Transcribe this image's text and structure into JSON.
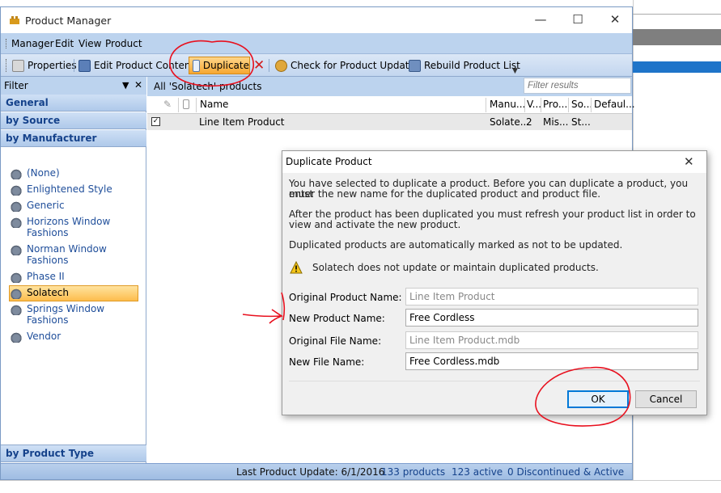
{
  "window": {
    "title": "Product Manager"
  },
  "menu": [
    "Manager",
    "Edit",
    "View",
    "Product"
  ],
  "toolbar": {
    "properties": "Properties",
    "edit_content": "Edit Product Content",
    "duplicate": "Duplicate",
    "check_updates": "Check for Product Updates",
    "rebuild": "Rebuild Product List"
  },
  "left": {
    "filter_label": "Filter",
    "general": "General",
    "by_source": "by Source",
    "by_manufacturer": "by Manufacturer",
    "manufacturers": [
      [
        "(None)"
      ],
      [
        "Enlightened Style"
      ],
      [
        "Generic"
      ],
      [
        "Horizons Window",
        "Fashions"
      ],
      [
        "Norman Window",
        "Fashions"
      ],
      [
        "Phase II"
      ],
      [
        "Solatech"
      ],
      [
        "Springs Window",
        "Fashions"
      ],
      [
        "Vendor"
      ]
    ],
    "selected_manufacturer": "Solatech",
    "by_product_type": "by Product Type"
  },
  "right": {
    "header": "All 'Solatech' products",
    "filter_placeholder": "Filter results",
    "columns": [
      "Name",
      "Manu...",
      "V...",
      "Pro...",
      "So...",
      "Defaul..."
    ],
    "rows": [
      {
        "name": "Line Item Product",
        "manu": "Solate...",
        "v": "2",
        "pro": "Mis...",
        "so": "St...",
        "default": ""
      }
    ]
  },
  "status": {
    "last_update": "Last Product Update: 6/1/2016",
    "products": "133 products",
    "active": "123 active",
    "discontinued": "0 Discontinued & Active"
  },
  "dialog": {
    "title": "Duplicate Product",
    "para1_line1": "You have selected to duplicate a product. Before you can duplicate a product, you must",
    "para1_line2": "enter the new name for the duplicated product and product file.",
    "para2_line1": "After the product has been duplicated you must refresh your product list in order to",
    "para2_line2": "view and activate the new product.",
    "para3": "Duplicated products are automatically marked as not to be updated.",
    "warning": "Solatech does not update or maintain duplicated products.",
    "original_product_label": "Original Product Name:",
    "original_product_value": "Line Item Product",
    "new_product_label": "New Product Name:",
    "new_product_value": "Free Cordless",
    "original_file_label": "Original File Name:",
    "original_file_value": "Line Item Product.mdb",
    "new_file_label": "New File Name:",
    "new_file_value": "Free Cordless.mdb",
    "ok": "OK",
    "cancel": "Cancel"
  },
  "colors": {
    "accent_blue": "#bcd3ee",
    "selected_orange": "#fdbd4d",
    "annotation_red": "#e8101e"
  }
}
